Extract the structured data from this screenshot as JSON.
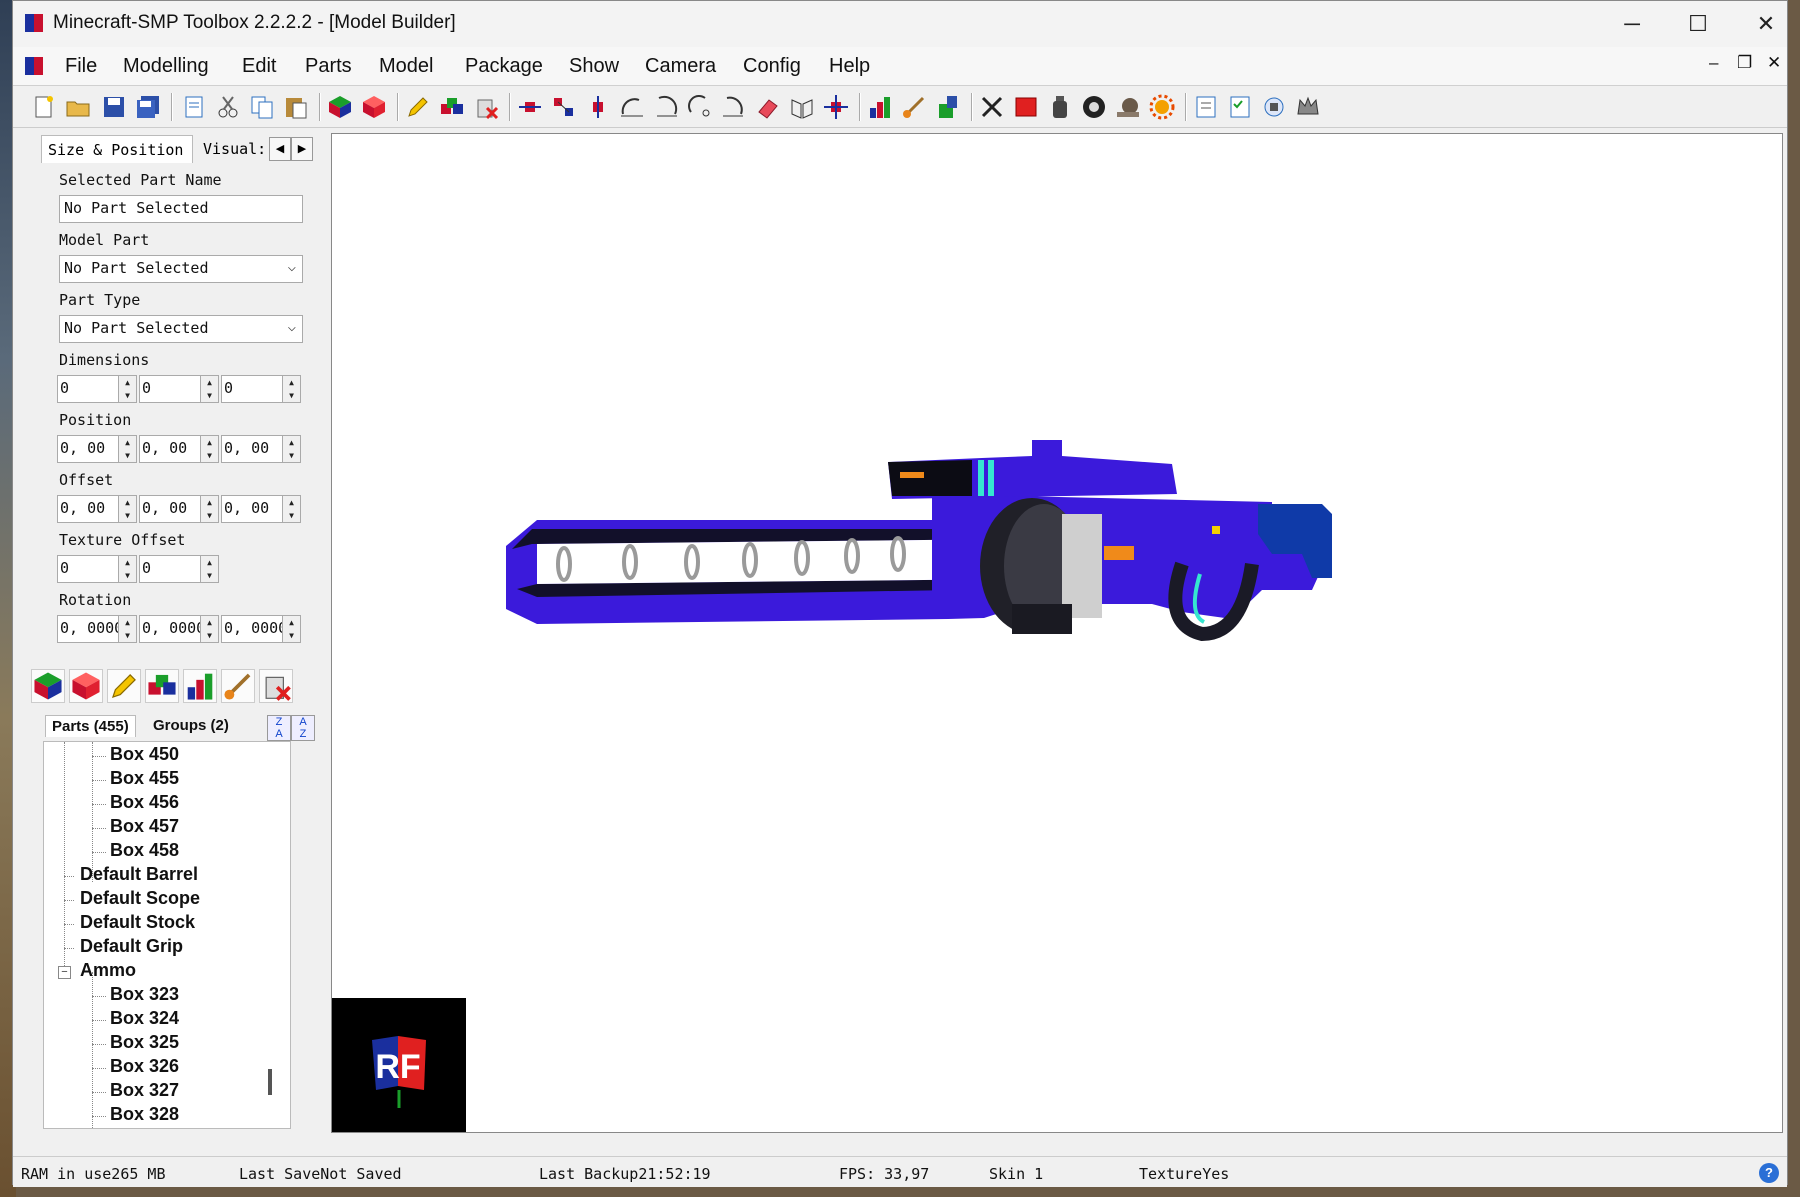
{
  "window": {
    "title": "Minecraft-SMP Toolbox 2.2.2.2 - [Model Builder]",
    "minimize": "─",
    "maximize": "☐",
    "close": "✕"
  },
  "menu": {
    "items": [
      "File",
      "Modelling",
      "Edit",
      "Parts",
      "Model",
      "Package",
      "Show",
      "Camera",
      "Config",
      "Help"
    ],
    "mdi_minimize": "–",
    "mdi_restore": "❐",
    "mdi_close": "✕"
  },
  "toolbar": {
    "icons": [
      "new-file-icon",
      "open-folder-icon",
      "save-icon",
      "save-all-icon",
      "page-icon",
      "cut-icon",
      "copy-icon",
      "paste-icon",
      "green-cube-icon",
      "red-cube-icon",
      "pencil-icon",
      "multi-cube-icon",
      "delete-parts-icon",
      "move-left-right-icon",
      "move-steps-icon",
      "move-up-down-icon",
      "rotate-x-icon",
      "rotate-y-icon",
      "rotate-z-icon",
      "rotate-alt-icon",
      "eraser-icon",
      "mirror-icon",
      "move-all-icon",
      "color-bars-icon",
      "brush-icon",
      "paint-bucket-icon",
      "cross-icon",
      "red-square-icon",
      "bottle-icon",
      "ball-icon",
      "snail-icon",
      "sun-icon",
      "list-icon",
      "checklist-icon",
      "tools-icon",
      "crown-icon"
    ]
  },
  "panel": {
    "tabs": [
      "Size & Position",
      "Visual:"
    ],
    "selected_part_name_label": "Selected Part Name",
    "selected_part_name_value": "No Part Selected",
    "model_part_label": "Model Part",
    "model_part_value": "No Part Selected",
    "part_type_label": "Part Type",
    "part_type_value": "No Part Selected",
    "dimensions_label": "Dimensions",
    "dimensions": [
      "0",
      "0",
      "0"
    ],
    "position_label": "Position",
    "position": [
      "0, 00",
      "0, 00",
      "0, 00"
    ],
    "offset_label": "Offset",
    "offset": [
      "0, 00",
      "0, 00",
      "0, 00"
    ],
    "texture_offset_label": "Texture Offset",
    "texture_offset": [
      "0",
      "0"
    ],
    "rotation_label": "Rotation",
    "rotation": [
      "0, 0000",
      "0, 0000",
      "0, 0000"
    ]
  },
  "parts": {
    "tabs": [
      "Parts (455)",
      "Groups (2)"
    ],
    "tree": [
      {
        "label": "Box 450",
        "level": 2
      },
      {
        "label": "Box 455",
        "level": 2
      },
      {
        "label": "Box 456",
        "level": 2
      },
      {
        "label": "Box 457",
        "level": 2
      },
      {
        "label": "Box 458",
        "level": 2
      },
      {
        "label": "Default Barrel",
        "level": 1
      },
      {
        "label": "Default Scope",
        "level": 1
      },
      {
        "label": "Default Stock",
        "level": 1
      },
      {
        "label": "Default Grip",
        "level": 1
      },
      {
        "label": "Ammo",
        "level": 1
      },
      {
        "label": "Box 323",
        "level": 2
      },
      {
        "label": "Box 324",
        "level": 2
      },
      {
        "label": "Box 325",
        "level": 2
      },
      {
        "label": "Box 326",
        "level": 2
      },
      {
        "label": "Box 327",
        "level": 2
      },
      {
        "label": "Box 328",
        "level": 2
      }
    ],
    "expander": "−"
  },
  "viewport": {
    "logo_text": "RF"
  },
  "status": {
    "ram": "RAM in use265 MB",
    "last_save": "Last SaveNot Saved",
    "last_backup": "Last Backup21:52:19",
    "fps": "FPS: 33,97",
    "skin": "Skin 1",
    "texture": "TextureYes",
    "help": "?"
  }
}
